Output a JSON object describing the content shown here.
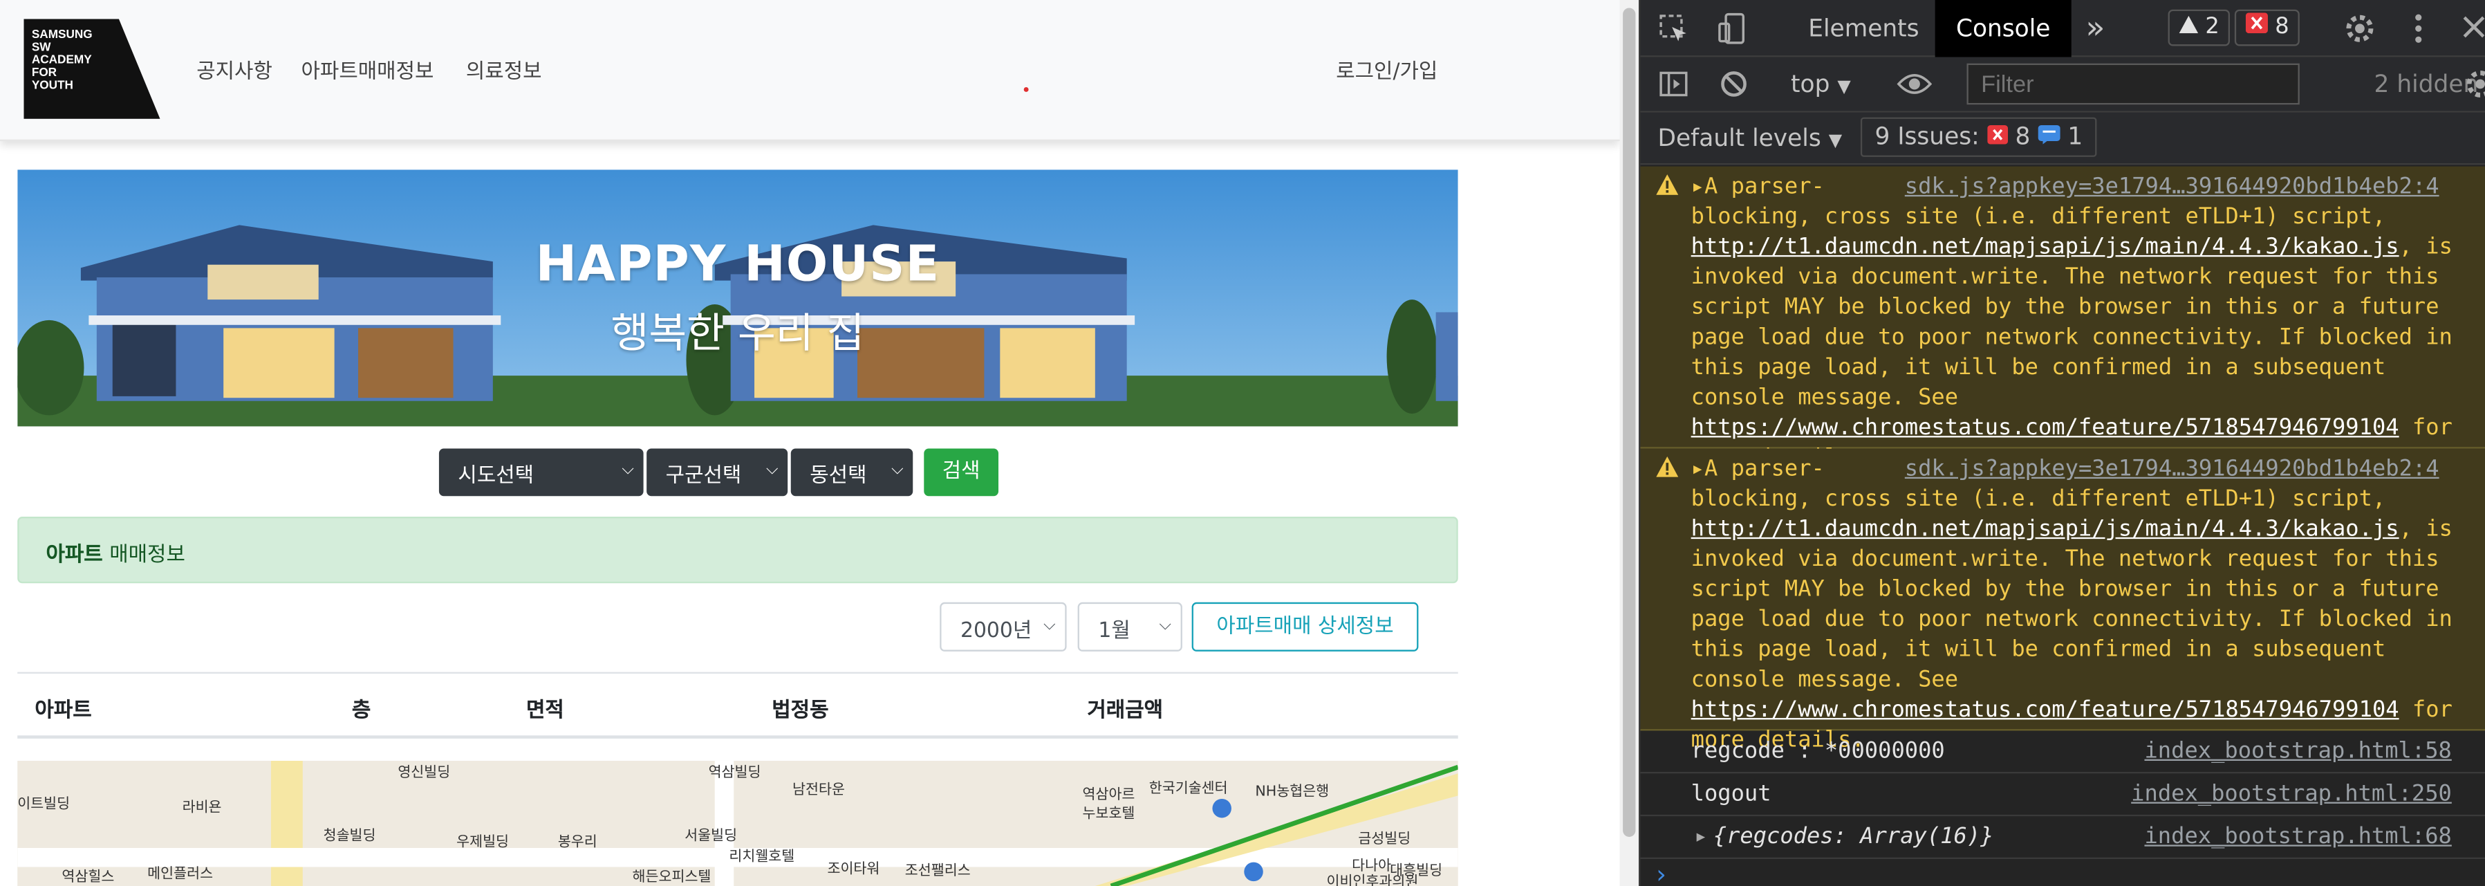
{
  "page": {
    "logo": {
      "lines": [
        "SAMSUNG",
        "SW",
        "ACADEMY",
        "FOR",
        "YOUTH"
      ]
    },
    "nav": [
      "공지사항",
      "아파트매매정보",
      "의료정보"
    ],
    "login_label": "로그인/가입",
    "banner": {
      "title": "HAPPY HOUSE",
      "subtitle": "행복한 우리 집"
    },
    "search": {
      "sido": "시도선택",
      "gugun": "구군선택",
      "dong": "동선택",
      "button": "검색"
    },
    "alert": {
      "bold": "아파트",
      "rest": " 매매정보"
    },
    "filters": {
      "year": "2000년",
      "month": "1월",
      "detail_button": "아파트매매 상세정보"
    },
    "table_headers": [
      "아파트",
      "층",
      "면적",
      "법정동",
      "거래금액"
    ],
    "map_labels": [
      "영신빌딩",
      "역삼빌딩",
      "남전타운",
      "역삼아르",
      "누보호텔",
      "한국기술센터",
      "NH농협은행",
      "이트빌딩",
      "라비욘",
      "청솔빌딩",
      "우제빌딩",
      "봉우리",
      "서울빌딩",
      "리치웰호텔",
      "금성빌딩",
      "역삼힐스",
      "메인플러스",
      "해든오피스텔",
      "조이타워",
      "조선팰리스",
      "다나아",
      "대흥빌딩",
      "이비인후과의원"
    ],
    "colors": {
      "success": "#28a745",
      "info": "#17a2b8",
      "dark": "#343a40",
      "alert_bg": "#d4edda"
    }
  },
  "devtools": {
    "tabs": [
      "Elements",
      "Console"
    ],
    "active_tab": "Console",
    "more_tabs": "»",
    "warning_count": "2",
    "error_count": "8",
    "context": "top",
    "filter_placeholder": "Filter",
    "hidden": "2 hidden",
    "levels": "Default levels",
    "issues": {
      "label": "9 Issues:",
      "errors": "8",
      "info": "1"
    },
    "messages": [
      {
        "type": "warning",
        "prefix": "A parser-",
        "source": "sdk.js?appkey=3e1794…391644920bd1b4eb2:4",
        "text1": "blocking, cross site (i.e. different eTLD+1) script, ",
        "link1": "http://t1.daumcdn.net/mapjsapi/js/main/4.4.3/kakao.js",
        "text2": ", is invoked via document.write. The network request for this script MAY be blocked by the browser in this or a future page load due to poor network connectivity. If blocked in this page load, it will be confirmed in a subsequent console message. See ",
        "link2": "https://www.chromestatus.com/feature/5718547946799104",
        "text3": " for more details."
      },
      {
        "type": "warning",
        "prefix": "A parser-",
        "source": "sdk.js?appkey=3e1794…391644920bd1b4eb2:4",
        "text1": "blocking, cross site (i.e. different eTLD+1) script, ",
        "link1": "http://t1.daumcdn.net/mapjsapi/js/main/4.4.3/kakao.js",
        "text2": ", is invoked via document.write. The network request for this script MAY be blocked by the browser in this or a future page load due to poor network connectivity. If blocked in this page load, it will be confirmed in a subsequent console message. See ",
        "link2": "https://www.chromestatus.com/feature/5718547946799104",
        "text3": " for more details."
      }
    ],
    "logs": [
      {
        "msg": "regcode : *00000000",
        "source": "index_bootstrap.html:58"
      },
      {
        "msg": "logout",
        "source": "index_bootstrap.html:250"
      },
      {
        "msg": "{regcodes: Array(16)}",
        "source": "index_bootstrap.html:68"
      }
    ],
    "prompt": "›",
    "colors": {
      "warning_bg": "#413a1c",
      "warning_text": "#f2c94c",
      "error": "#e8383d",
      "info": "#3f8ae2"
    }
  }
}
